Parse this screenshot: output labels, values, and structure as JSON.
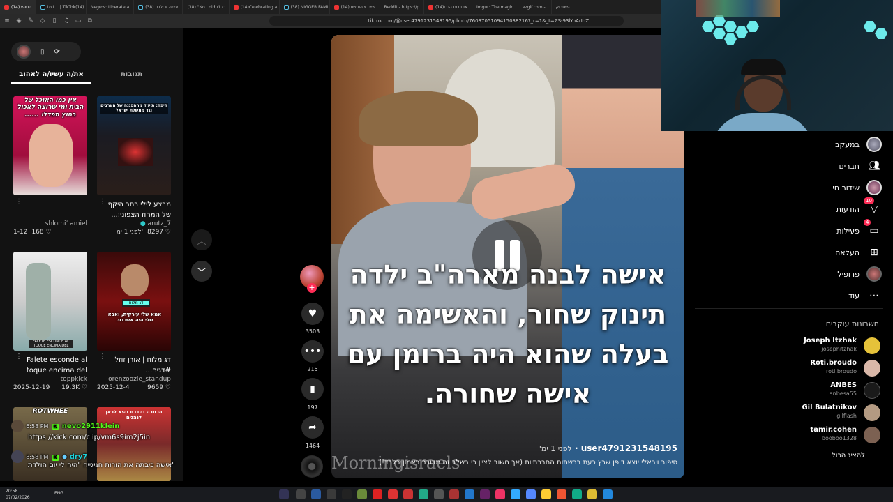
{
  "browser": {
    "tabs": [
      {
        "label": "פייסבוק"
      },
      {
        "label": "(14)סטופר"
      },
      {
        "label": "to t... | TikTok(14)"
      },
      {
        "label": "Negros: Liberate a"
      },
      {
        "label": "(38) אישה זו ילדה"
      },
      {
        "label": "(38) \"No I didn't c"
      },
      {
        "label": "(14)Celebrating a"
      },
      {
        "label": "(38) NIGGER FAMI"
      },
      {
        "label": "(14)שייט זיוהוהשוני"
      },
      {
        "label": "Reddit - https://p"
      },
      {
        "label": "(14)אוטובוס הגבו"
      },
      {
        "label": "Imgur: The magic"
      },
      {
        "label": "ezgif.com -"
      }
    ],
    "url": "tiktok.com/@user4791231548195/photo/7603705109415038216?_r=1&_t=ZS-93lYoArIhZ"
  },
  "left_panel": {
    "tabs": [
      {
        "label": "את/ה עשיו/ה לאהוב"
      },
      {
        "label": "תגובות"
      }
    ],
    "cards": [
      {
        "caption": "אין כמו האוכל של הבית ומי שרוצה לאכול בחוץ תפדלו ......",
        "title": "",
        "author": "shlomi1amiel",
        "date": "1-12",
        "likes": "168"
      },
      {
        "caption": "חיפה: תיעוד מההפגנה של הערבים נגד ממשלת ישראל",
        "title": "מבצע לילי רחב היקף של המחוז הצפוני:...",
        "author": "arutz_7",
        "date": "לפני 1 ימ'",
        "likes": "8297"
      },
      {
        "caption": "FALETE ESCONDE AL TOQUE ENCIMA DEL",
        "title": "Falete esconde al toque encima del",
        "author": "toppkick",
        "date": "2025-12-19",
        "likes": "19.3K"
      },
      {
        "caption": "דג מלוח",
        "caption2": "אמא שלי עירקית, ואבא שלי היה אשכנזי.",
        "title": "דג מלוח | אורן זוזל #דגים...",
        "author": "orenzoozle_standup",
        "date": "2025-12-4",
        "likes": "9659"
      },
      {
        "caption": "ROTWHEE",
        "title": "",
        "author": "",
        "date": "",
        "likes": ""
      },
      {
        "caption": "הכתבה נהדרת והיא לכאן לנהגים",
        "title": "",
        "author": "",
        "date": "",
        "likes": ""
      }
    ]
  },
  "chat": [
    {
      "time": "6:58 PM",
      "user": "nevo2911klein",
      "message": ""
    },
    {
      "time": "",
      "user": "",
      "message": "https://kick.com/clip/vm6s9im2j5in"
    },
    {
      "time": "8:58 PM",
      "user": "dry7",
      "message": ""
    },
    {
      "time": "",
      "user": "",
      "message": "\"אישה כיבתה את הורות חגיגייה \"היה לי יום הולדת"
    }
  ],
  "actions": {
    "likes": "3503",
    "comments": "215",
    "saves": "197",
    "shares": "1464"
  },
  "video": {
    "overlay_text": "אישה לבנה מארה\"ב ילדה תינוק שחור, והאשימה את בעלה שהוא היה ברומן עם אישה שחורה.",
    "author": "user4791231548195",
    "posted": "לפני 1 ימ'",
    "description": "סיפור ויראלי יוצא דופן שרץ כעת ברשתות החברתיות (אך חשוב לציין כי בשלב זה מדובר באמון בלבד!)",
    "watermark": "Morningisraels"
  },
  "right_nav": {
    "items": [
      {
        "label": "במעקב",
        "icon": "avatar",
        "badge": ""
      },
      {
        "label": "חברים",
        "icon": "friends-icon",
        "badge": ""
      },
      {
        "label": "שידור חי",
        "icon": "live-icon",
        "badge": ""
      },
      {
        "label": "הודעות",
        "icon": "inbox-icon",
        "badge": "10"
      },
      {
        "label": "פעילות",
        "icon": "activity-icon",
        "badge": "4"
      },
      {
        "label": "העלאה",
        "icon": "upload-icon",
        "badge": ""
      },
      {
        "label": "פרופיל",
        "icon": "profile-icon",
        "badge": ""
      },
      {
        "label": "עוד",
        "icon": "more-icon",
        "badge": ""
      }
    ],
    "following_heading": "חשבונות עוקבים",
    "following": [
      {
        "name": "Joseph Itzhak",
        "handle": "josephitzhak",
        "color": "#e5c23a"
      },
      {
        "name": "Roti.broudo",
        "handle": "roti.broudo",
        "color": "#d9b7a8"
      },
      {
        "name": "ANBES",
        "handle": "anbesa55",
        "color": "#1a1a1a"
      },
      {
        "name": "Gil Bulatnikov",
        "handle": "gilflash",
        "color": "#b39a82"
      },
      {
        "name": "tamir.cohen",
        "handle": "booboo1328",
        "color": "#7c6152"
      }
    ],
    "show_all": "להציג הכול"
  },
  "taskbar": {
    "time": "20:58",
    "date": "07/02/2026",
    "lang": "ENG"
  },
  "colors": {
    "accent": "#fe2c55",
    "kick": "#53fc18"
  }
}
